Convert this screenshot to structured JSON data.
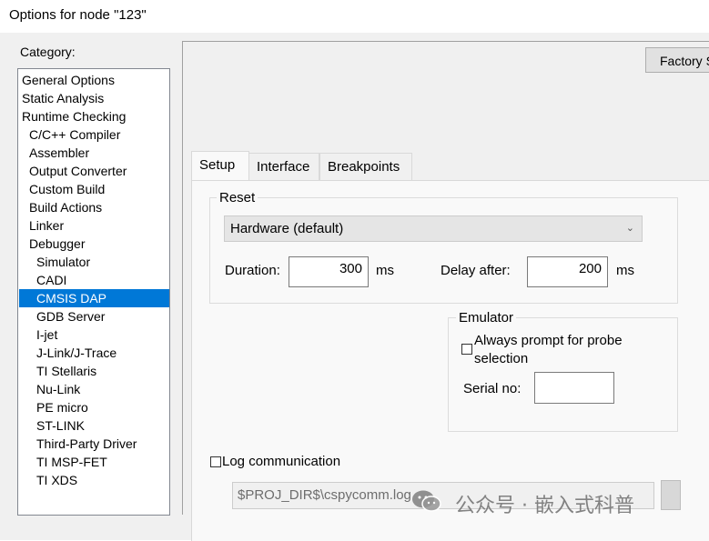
{
  "window": {
    "title": "Options for node \"123\""
  },
  "category": {
    "label": "Category:",
    "items": [
      "General Options",
      "Static Analysis",
      "Runtime Checking",
      "C/C++ Compiler",
      "Assembler",
      "Output Converter",
      "Custom Build",
      "Build Actions",
      "Linker",
      "Debugger",
      "Simulator",
      "CADI",
      "CMSIS DAP",
      "GDB Server",
      "I-jet",
      "J-Link/J-Trace",
      "TI Stellaris",
      "Nu-Link",
      "PE micro",
      "ST-LINK",
      "Third-Party Driver",
      "TI MSP-FET",
      "TI XDS"
    ],
    "selected": "CMSIS DAP"
  },
  "factory_button": "Factory S",
  "tabs": [
    "Setup",
    "Interface",
    "Breakpoints"
  ],
  "active_tab": "Setup",
  "reset": {
    "title": "Reset",
    "mode": "Hardware (default)",
    "duration_label": "Duration:",
    "duration_value": "300",
    "duration_unit": "ms",
    "delay_label": "Delay after:",
    "delay_value": "200",
    "delay_unit": "ms"
  },
  "emulator": {
    "title": "Emulator",
    "always_prompt_label": "Always prompt for probe selection",
    "always_prompt_line1": "Always prompt for probe",
    "always_prompt_line2": "selection",
    "always_prompt_checked": false,
    "serial_label": "Serial no:",
    "serial_value": ""
  },
  "log": {
    "label": "Log communication",
    "checked": false,
    "path": "$PROJ_DIR$\\cspycomm.log"
  },
  "watermark": {
    "text": "公众号 · 嵌入式科普"
  },
  "colors": {
    "selection": "#0078d7",
    "dialog_bg": "#f0f0f0",
    "tab_bg": "#f9f9f9"
  }
}
